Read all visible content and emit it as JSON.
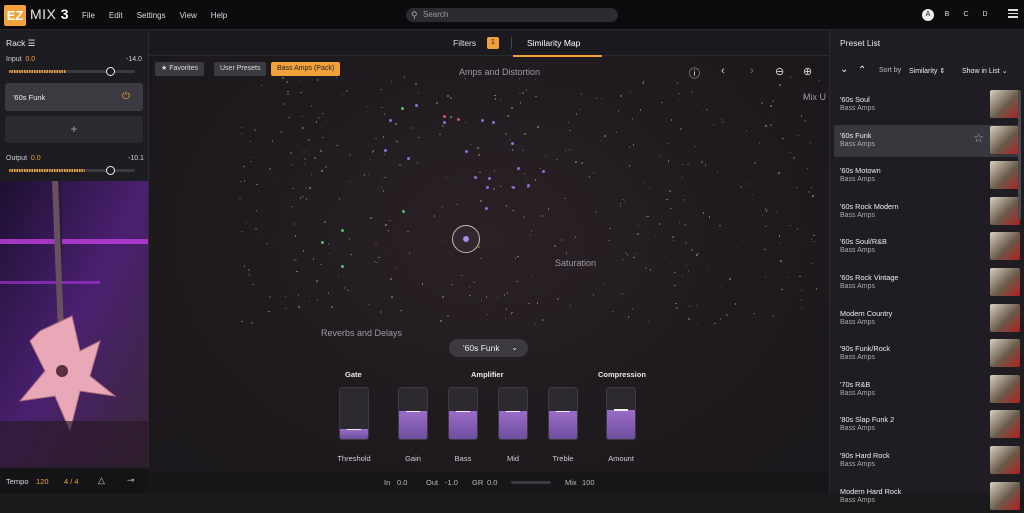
{
  "app": {
    "logo": "EZ",
    "name": "MIX",
    "version": "3"
  },
  "menu": [
    "File",
    "Edit",
    "Settings",
    "View",
    "Help"
  ],
  "search": {
    "placeholder": "Search"
  },
  "snapshots": [
    "A",
    "B",
    "C",
    "D"
  ],
  "rack": {
    "title": "Rack",
    "input_label": "Input",
    "input_value": "0.0",
    "input_peak": "-14.0",
    "input_level": 0.45,
    "slot_name": "'60s Funk",
    "output_label": "Output",
    "output_value": "0.0",
    "output_peak": "-10.1",
    "output_level": 0.6,
    "add_label": "+"
  },
  "footer_left": {
    "tempo_label": "Tempo",
    "tempo_value": "120",
    "signature": "4 / 4"
  },
  "tabs": {
    "filters": "Filters",
    "filters_count": "1",
    "similarity": "Similarity Map"
  },
  "filter_chips": {
    "favorites": "Favorites",
    "user_presets": "User Presets",
    "pack": "Bass Amps (Pack)"
  },
  "map": {
    "label_amps": "Amps and Distortion",
    "label_mix": "Mix U",
    "label_saturation": "Saturation",
    "label_reverbs": "Reverbs and Delays"
  },
  "preset_selector": {
    "value": "'60s Funk"
  },
  "controls": {
    "gate": "Gate",
    "amplifier": "Amplifier",
    "compression": "Compression",
    "faders": [
      {
        "label": "Threshold",
        "level": 0.18
      },
      {
        "label": "Gain",
        "level": 0.52
      },
      {
        "label": "Bass",
        "level": 0.52
      },
      {
        "label": "Mid",
        "level": 0.52
      },
      {
        "label": "Treble",
        "level": 0.52
      },
      {
        "label": "Amount",
        "level": 0.55
      }
    ]
  },
  "bottom_bar": {
    "in_label": "In",
    "in_value": "0.0",
    "out_label": "Out",
    "out_value": "-1.0",
    "gr_label": "GR",
    "gr_value": "0.0",
    "mix_label": "Mix",
    "mix_value": "100"
  },
  "preset_list": {
    "title": "Preset List",
    "sort_label": "Sort by",
    "sort_value": "Similarity",
    "show_value": "Show in List",
    "items": [
      {
        "name": "'60s Soul",
        "category": "Bass Amps"
      },
      {
        "name": "'60s Funk",
        "category": "Bass Amps",
        "active": true
      },
      {
        "name": "'60s Motown",
        "category": "Bass Amps"
      },
      {
        "name": "'60s Rock Modern",
        "category": "Bass Amps"
      },
      {
        "name": "'60s Soul/R&B",
        "category": "Bass Amps"
      },
      {
        "name": "'60s Rock Vintage",
        "category": "Bass Amps"
      },
      {
        "name": "Modern Country",
        "category": "Bass Amps"
      },
      {
        "name": "'90s Funk/Rock",
        "category": "Bass Amps"
      },
      {
        "name": "'70s R&B",
        "category": "Bass Amps"
      },
      {
        "name": "'80s Slap Funk 2",
        "category": "Bass Amps"
      },
      {
        "name": "'90s Hard Rock",
        "category": "Bass Amps"
      },
      {
        "name": "Modern Hard Rock",
        "category": "Bass Amps"
      }
    ]
  },
  "colors": {
    "accent": "#f2a13a",
    "purple": "#8b6fd8"
  }
}
